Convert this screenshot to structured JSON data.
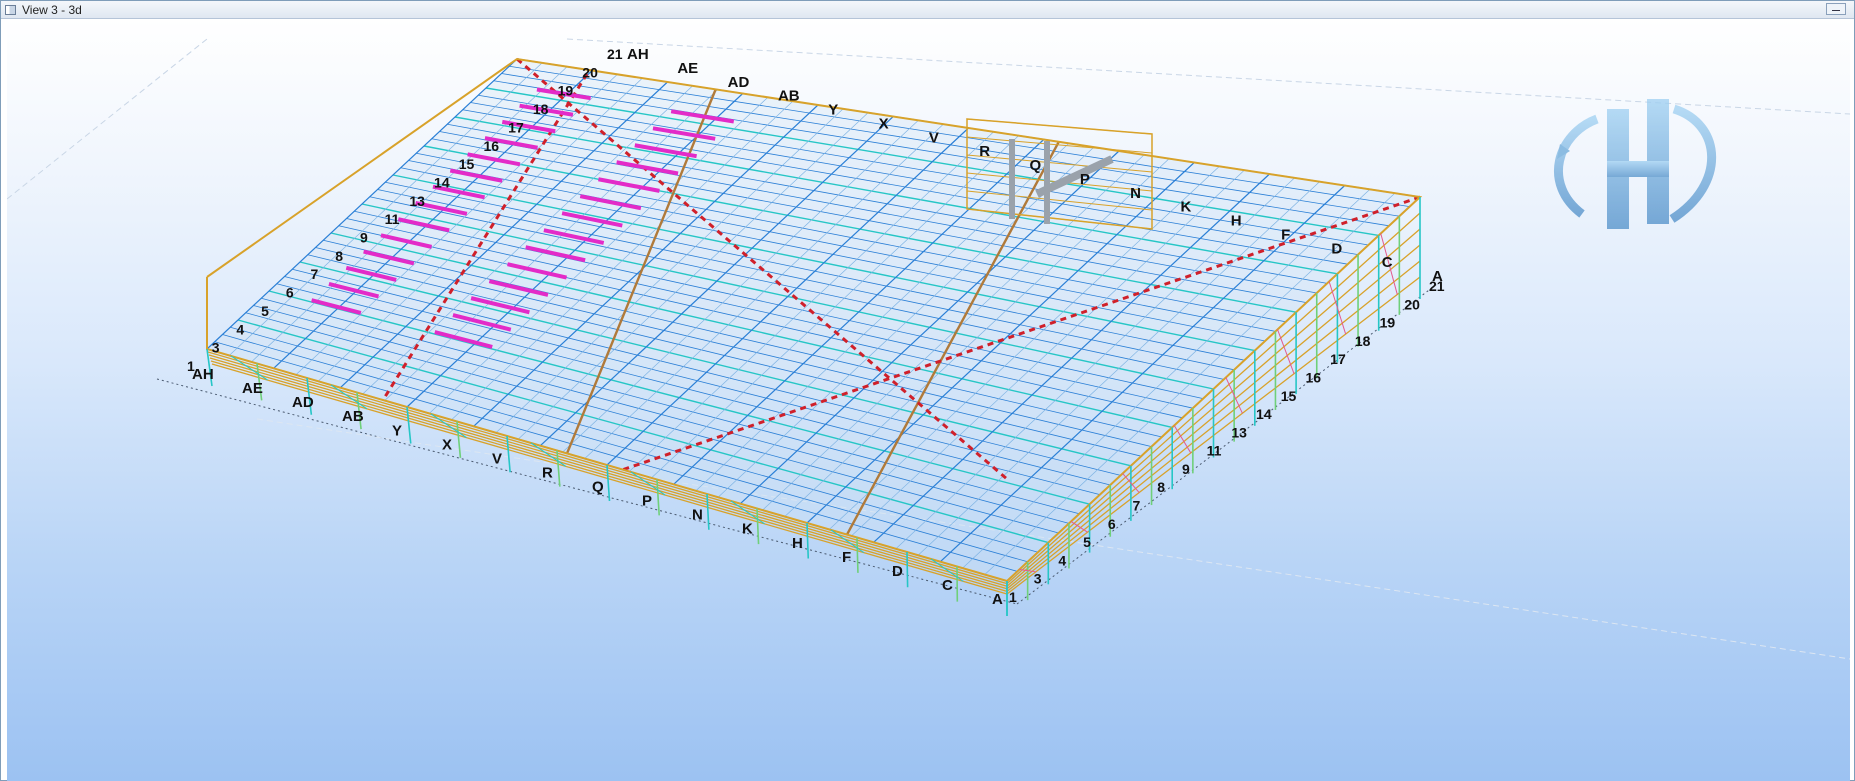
{
  "window": {
    "title": "View 3 - 3d"
  },
  "colors": {
    "frame": "#d8a22a",
    "purlin_blue": "#2a7fd6",
    "bracing_cyan": "#26c6c6",
    "rafter_pink": "#e32bc8",
    "ridge_red": "#d0202a",
    "green": "#6fd07a"
  },
  "grid": {
    "front_letters": [
      "AH",
      "AE",
      "AD",
      "AB",
      "Y",
      "X",
      "V",
      "R",
      "Q",
      "P",
      "N",
      "K",
      "H",
      "F",
      "D",
      "C",
      "A"
    ],
    "right_numbers": [
      "1",
      "3",
      "4",
      "5",
      "6",
      "7",
      "8",
      "9",
      "11",
      "13",
      "14",
      "15",
      "16",
      "17",
      "18",
      "19",
      "20",
      "21"
    ],
    "left_numbers": [
      "1",
      "3",
      "4",
      "5",
      "6",
      "7",
      "8",
      "9",
      "11",
      "13",
      "14",
      "15",
      "16",
      "17",
      "18",
      "19",
      "20",
      "21"
    ],
    "back_letters": [
      "AH",
      "AE",
      "AD",
      "AB",
      "Y",
      "X",
      "V",
      "R",
      "Q",
      "P",
      "N",
      "K",
      "H",
      "F",
      "D",
      "C",
      "A"
    ]
  },
  "watermark": {
    "icon": "company-logo-icon"
  }
}
